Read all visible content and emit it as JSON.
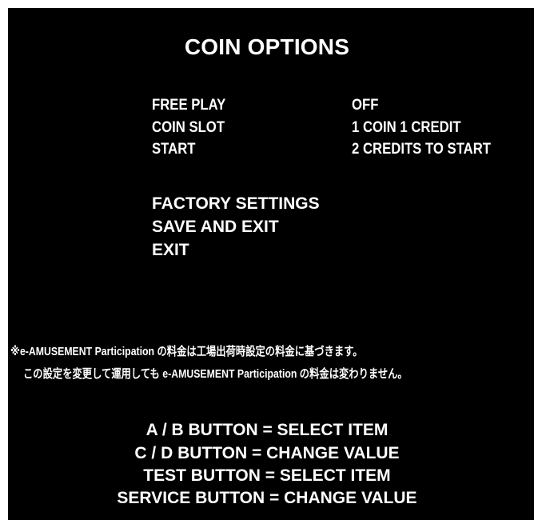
{
  "screen": {
    "title": "COIN OPTIONS",
    "options": [
      {
        "label": "FREE PLAY",
        "value": "OFF"
      },
      {
        "label": "COIN SLOT",
        "value": "1 COIN 1 CREDIT"
      },
      {
        "label": "START",
        "value": "2 CREDITS TO START"
      }
    ],
    "menu": [
      "FACTORY SETTINGS",
      "SAVE AND EXIT",
      "EXIT"
    ],
    "note": [
      "※e-AMUSEMENT Participation の料金は工場出荷時設定の料金に基づきます。",
      "この設定を変更して運用しても e-AMUSEMENT Participation の料金は変わりません。"
    ],
    "help": [
      "A / B BUTTON = SELECT ITEM",
      "C / D BUTTON = CHANGE  VALUE",
      "TEST BUTTON = SELECT ITEM",
      "SERVICE BUTTON = CHANGE  VALUE"
    ]
  },
  "colors": {
    "background": "#000000",
    "text": "#ffffff",
    "frame": "#ffffff"
  }
}
